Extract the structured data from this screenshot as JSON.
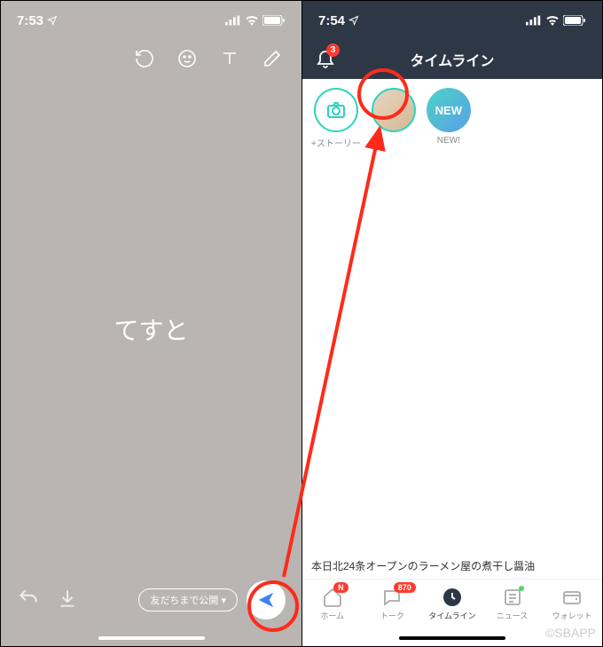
{
  "left": {
    "status_time": "7:53",
    "content_text": "てすと",
    "privacy_label": "友だちまで公開"
  },
  "right": {
    "status_time": "7:54",
    "header_title": "タイムライン",
    "bell_badge": "3",
    "stories": {
      "add_label": "+ストーリー",
      "new_text": "NEW",
      "new_label": "NEW!"
    },
    "feed_snippet": "本日北24条オープンのラーメン屋の煮干し醤油",
    "tabs": {
      "home": "ホーム",
      "home_badge": "N",
      "talk": "トーク",
      "talk_badge": "870",
      "timeline": "タイムライン",
      "news": "ニュース",
      "wallet": "ウォレット"
    }
  },
  "watermark": "©SBAPP"
}
